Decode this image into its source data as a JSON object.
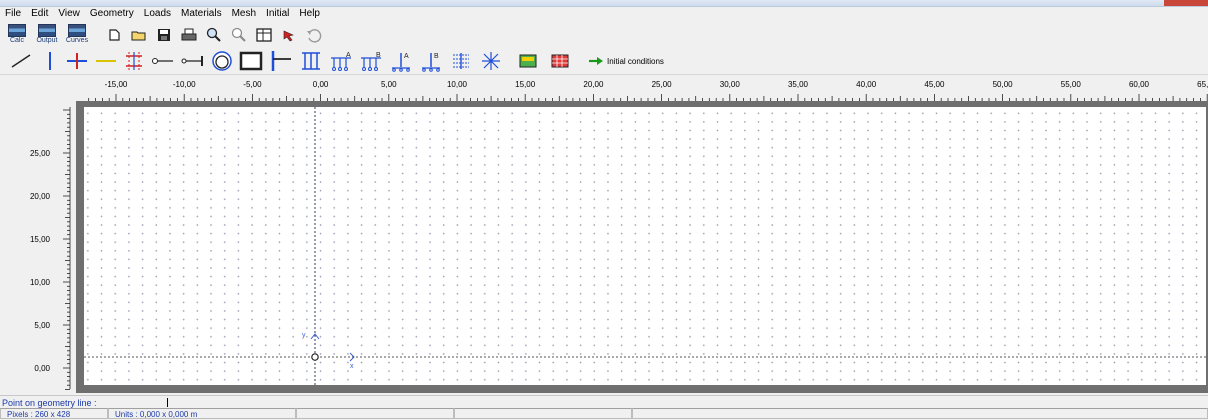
{
  "menu": [
    "File",
    "Edit",
    "View",
    "Geometry",
    "Loads",
    "Materials",
    "Mesh",
    "Initial",
    "Help"
  ],
  "toolbar": {
    "calc_label": "Calc",
    "output_label": "Output",
    "curves_label": "Curves"
  },
  "geometry_toolbar": {
    "initial_conditions_label": "Initial conditions",
    "icons": [
      "line-icon",
      "node-icon",
      "interface-icon",
      "fixed-end-anchor-icon",
      "node-to-node-anchor-icon",
      "tunnel-icon",
      "plate-icon",
      "geogrid-icon",
      "standard-fixities-icon",
      "prescribed-displacement-icon",
      "load-a-icon",
      "load-b-icon",
      "point-load-a-icon",
      "point-load-b-icon",
      "drain-icon",
      "well-icon",
      "materials-icon",
      "mesh-icon",
      "arrow-right-icon"
    ]
  },
  "ruler": {
    "x_ticks": [
      "-15,00",
      "-10,00",
      "-5,00",
      "0,00",
      "5,00",
      "10,00",
      "15,00",
      "20,00",
      "25,00",
      "30,00",
      "35,00",
      "40,00",
      "45,00",
      "50,00",
      "55,00",
      "60,00",
      "65,00"
    ],
    "y_ticks": [
      "25,00",
      "20,00",
      "15,00",
      "10,00",
      "5,00",
      "0,00"
    ]
  },
  "canvas": {
    "x_axis_label": "x",
    "y_axis_label": "y"
  },
  "status": {
    "prompt": "Point on geometry line :",
    "pixels": "Pixels : 260 x 428",
    "units": "Units : 0,000 x 0,000 m"
  },
  "colors": {
    "accent_blue": "#1a3aa8",
    "line_yellow": "#d8c400",
    "canvas_frame": "#6f6f6f"
  }
}
